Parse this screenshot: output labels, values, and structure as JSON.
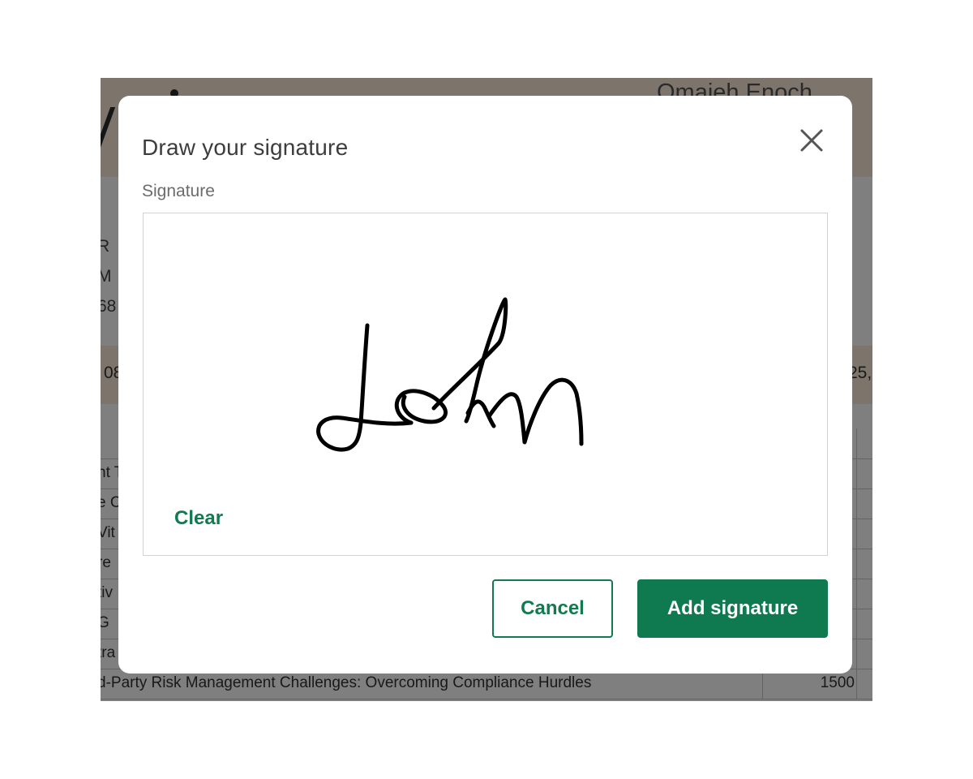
{
  "background_document": {
    "company_name": "Omaieh Enoch",
    "meta_lines": [
      "R",
      "M",
      "68"
    ],
    "band_left": "08",
    "band_right": "25,",
    "rows": [
      {
        "title": "",
        "amount": ""
      },
      {
        "title": "nt T",
        "amount": ""
      },
      {
        "title": "e C",
        "amount": ""
      },
      {
        "title": "Vit",
        "amount": ""
      },
      {
        "title": "re",
        "amount": ""
      },
      {
        "title": "tiv",
        "amount": ""
      },
      {
        "title": "G",
        "amount": ""
      },
      {
        "title": "tra",
        "amount": ""
      },
      {
        "title": "d-Party Risk Management Challenges: Overcoming Compliance Hurdles",
        "amount": "1500"
      }
    ]
  },
  "modal": {
    "title": "Draw your signature",
    "close_icon": "close-icon",
    "field_label": "Signature",
    "signature_text": "John",
    "clear_label": "Clear",
    "cancel_label": "Cancel",
    "add_label": "Add signature",
    "accent_color": "#0f7a50"
  }
}
